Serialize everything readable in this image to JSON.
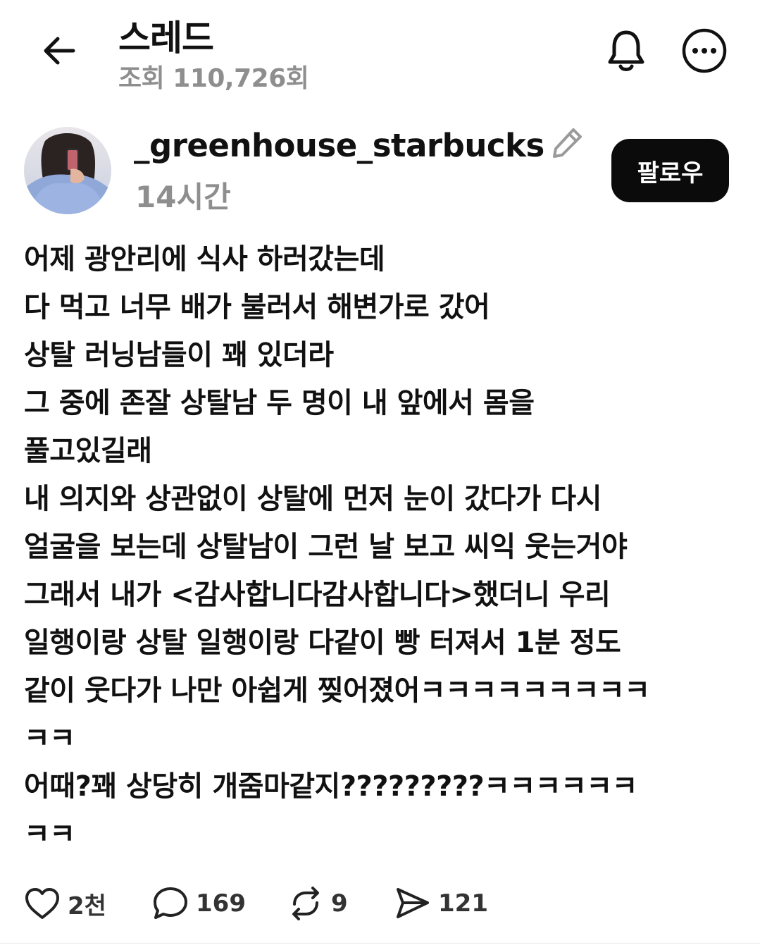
{
  "header": {
    "title": "스레드",
    "views": "조회 110,726회"
  },
  "post": {
    "username": "_greenhouse_starbucks",
    "time": "14시간",
    "follow_label": "팔로우",
    "lines": [
      "어제 광안리에 식사 하러갔는데",
      "다 먹고 너무 배가 불러서 해변가로 갔어",
      "상탈 러닝남들이 꽤 있더라",
      "그 중에 존잘 상탈남 두 명이 내 앞에서 몸을",
      "풀고있길래",
      "내 의지와 상관없이 상탈에 먼저 눈이 갔다가 다시",
      "얼굴을 보는데 상탈남이 그런 날 보고 씨익 웃는거야",
      "그래서 내가 <감사합니다감사합니다>했더니 우리",
      "일행이랑 상탈 일행이랑 다같이 빵 터져서 1분 정도",
      "같이 웃다가 나만 아쉽게 찢어졌어ㅋㅋㅋㅋㅋㅋㅋㅋㅋ",
      "ㅋㅋ",
      "어때?꽤 상당히 개줌마같지?????????ㅋㅋㅋㅋㅋㅋ",
      "ㅋㅋ"
    ]
  },
  "actions": {
    "likes": "2천",
    "comments": "169",
    "reposts": "9",
    "shares": "121"
  },
  "icons": {
    "back": "arrow-left-icon",
    "bell": "bell-icon",
    "more": "more-horizontal-icon",
    "edit": "pencil-icon",
    "like": "heart-icon",
    "comment": "comment-icon",
    "repost": "repost-icon",
    "share": "send-icon"
  }
}
